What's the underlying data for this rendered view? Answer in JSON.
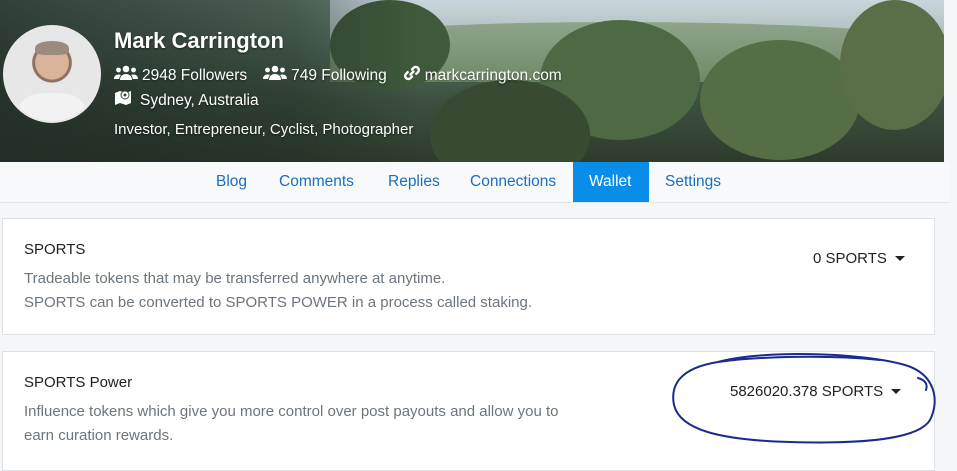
{
  "profile": {
    "name": "Mark Carrington",
    "followers": "2948 Followers",
    "following": "749 Following",
    "website": "markcarrington.com",
    "location": "Sydney, Australia",
    "bio": "Investor, Entrepreneur, Cyclist, Photographer",
    "icons": {
      "followers": "users-icon",
      "following": "users-icon",
      "website": "link-icon",
      "location": "map-marker-icon"
    }
  },
  "tabs": [
    {
      "label": "Blog"
    },
    {
      "label": "Comments"
    },
    {
      "label": "Replies"
    },
    {
      "label": "Connections"
    },
    {
      "label": "Wallet",
      "active": true
    },
    {
      "label": "Settings"
    }
  ],
  "wallet": {
    "sports": {
      "title": "SPORTS",
      "desc_line1": "Tradeable tokens that may be transferred anywhere at anytime.",
      "desc_line2": "SPORTS can be converted to SPORTS POWER in a process called staking.",
      "balance": "0 SPORTS"
    },
    "sports_power": {
      "title": "SPORTS Power",
      "desc_line1": "Influence tokens which give you more control over post payouts and allow you to",
      "desc_line2": "earn curation rewards.",
      "balance": "5826020.378 SPORTS"
    }
  },
  "colors": {
    "accent": "#0a8de8",
    "link": "#1a6fbf",
    "muted_text": "#6c757d",
    "annotation_ink": "#1c2a8c"
  }
}
